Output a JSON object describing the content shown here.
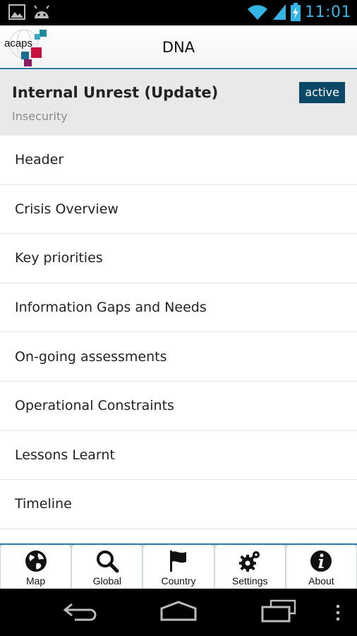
{
  "status_bar": {
    "time": "11:01",
    "icons": [
      "gallery-icon",
      "android-icon",
      "wifi-icon",
      "signal-icon",
      "battery-charging-icon"
    ]
  },
  "header": {
    "logo_text": "acaps",
    "title": "DNA"
  },
  "crisis": {
    "title": "Internal Unrest (Update)",
    "subtitle": "Insecurity",
    "status": "active",
    "status_color": "#0b4868"
  },
  "sections": [
    {
      "label": "Header"
    },
    {
      "label": "Crisis Overview"
    },
    {
      "label": "Key priorities"
    },
    {
      "label": "Information Gaps and Needs"
    },
    {
      "label": "On-going assessments"
    },
    {
      "label": "Operational Constraints"
    },
    {
      "label": "Lessons Learnt"
    },
    {
      "label": "Timeline"
    }
  ],
  "tabs": [
    {
      "label": "Map",
      "icon": "globe-icon"
    },
    {
      "label": "Global",
      "icon": "search-icon"
    },
    {
      "label": "Country",
      "icon": "flag-icon"
    },
    {
      "label": "Settings",
      "icon": "gears-icon"
    },
    {
      "label": "About",
      "icon": "info-icon"
    }
  ],
  "colors": {
    "accent": "#2a7ea6",
    "status_time": "#33b5e5"
  }
}
